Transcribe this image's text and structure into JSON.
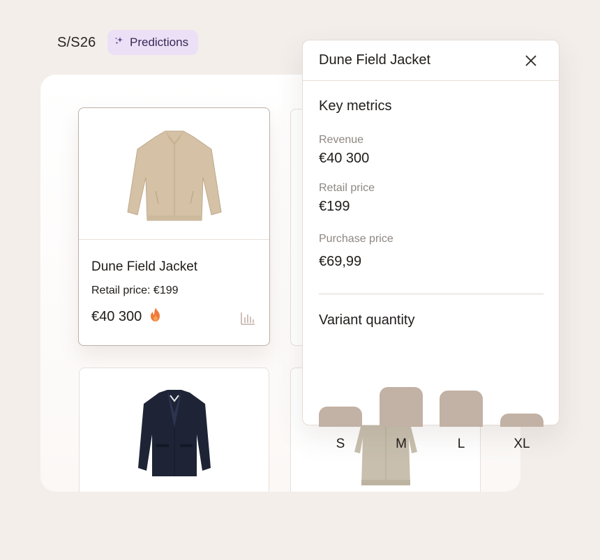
{
  "header": {
    "season": "S/S26",
    "predictions_label": "Predictions"
  },
  "products": [
    {
      "name": "Dune Field Jacket",
      "retail_price_text": "Retail price: €199",
      "revenue": "€40 300",
      "selected": true
    }
  ],
  "panel": {
    "title": "Dune Field Jacket",
    "key_metrics_title": "Key metrics",
    "metrics": [
      {
        "label": "Revenue",
        "value": "€40 300"
      },
      {
        "label": "Retail price",
        "value": "€199"
      },
      {
        "label": "Purchase price",
        "value": "€69,99"
      }
    ],
    "variant_title": "Variant quantity",
    "variant_chart": {
      "type": "bar",
      "categories": [
        "S",
        "M",
        "L",
        "XL"
      ],
      "values": [
        0.5,
        1.0,
        0.92,
        0.34
      ]
    }
  },
  "colors": {
    "background": "#f3eeea",
    "chip_bg": "#ece0f6",
    "bar": "#c2b1a5",
    "fire": "#f07a3a"
  }
}
